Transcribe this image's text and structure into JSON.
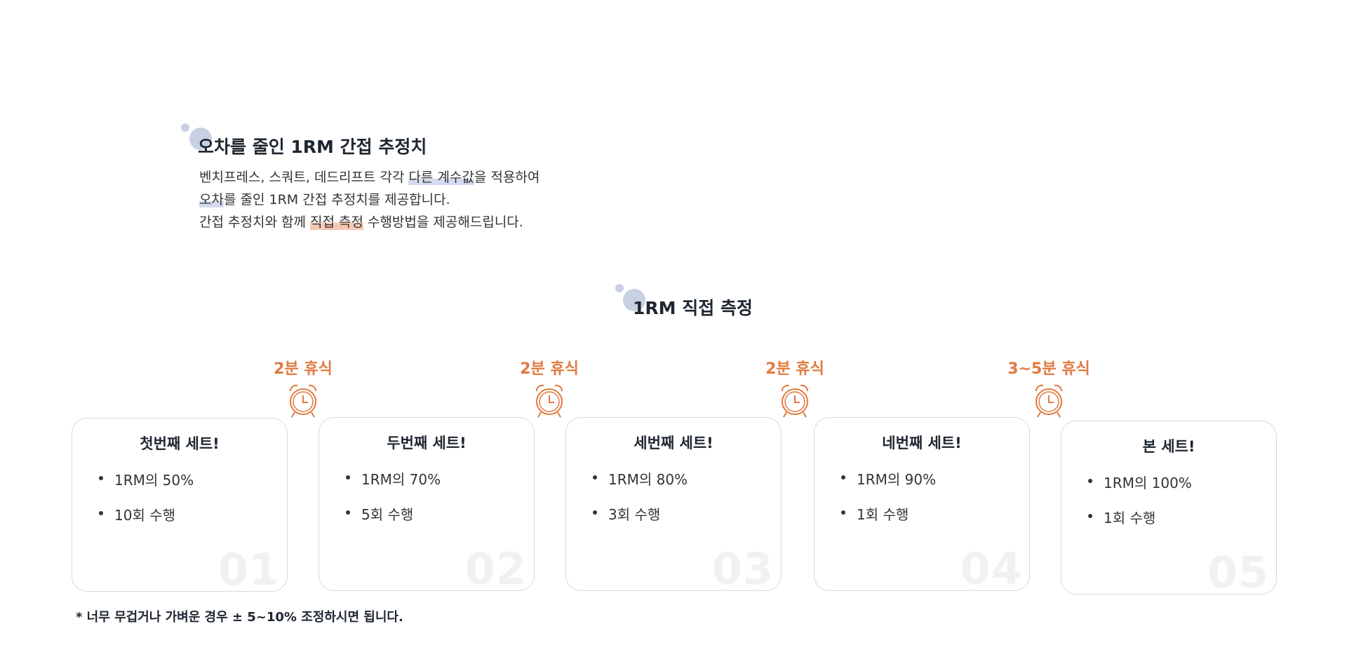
{
  "estimate": {
    "title": "오차를 줄인 1RM 간접 추정치",
    "line1_a": "벤치프레스, 스쿼트, 데드리프트 각각 ",
    "line1_hl": "다른 계수값",
    "line1_b": "을 적용하여",
    "line2_hl": "오차",
    "line2_b": "를 줄인 1RM 간접 추정치를 제공합니다.",
    "line3_a": "간접 추정치와 함께 ",
    "line3_hl": "직접 측정",
    "line3_b": " 수행방법을 제공해드립니다."
  },
  "direct": {
    "title": "1RM 직접 측정"
  },
  "rests": [
    {
      "label": "2분 휴식",
      "icon": "alarm-clock-icon"
    },
    {
      "label": "2분 휴식",
      "icon": "alarm-clock-icon"
    },
    {
      "label": "2분 휴식",
      "icon": "alarm-clock-icon"
    },
    {
      "label": "3~5분 휴식",
      "icon": "alarm-clock-icon"
    }
  ],
  "sets": [
    {
      "title": "첫번째 세트!",
      "items": [
        "1RM의 50%",
        "10회 수행"
      ],
      "number": "01"
    },
    {
      "title": "두번째 세트!",
      "items": [
        "1RM의 70%",
        "5회 수행"
      ],
      "number": "02"
    },
    {
      "title": "세번째 세트!",
      "items": [
        "1RM의 80%",
        "3회 수행"
      ],
      "number": "03"
    },
    {
      "title": "네번째 세트!",
      "items": [
        "1RM의 90%",
        "1회 수행"
      ],
      "number": "04"
    },
    {
      "title": "본 세트!",
      "items": [
        "1RM의 100%",
        "1회 수행"
      ],
      "number": "05"
    }
  ],
  "footnote": "* 너무 무겁거나 가벼운 경우 ± 5~10% 조정하시면 됩니다.",
  "colors": {
    "accent_orange": "#e07a3f",
    "highlight_blue": "#d4dbef",
    "highlight_orange": "#f6c9b4",
    "deco_circle": "#c8d0e3",
    "heading": "#1e2630"
  }
}
